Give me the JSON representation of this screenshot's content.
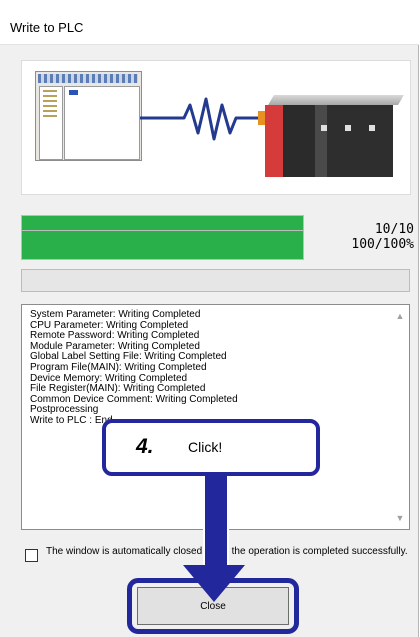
{
  "window": {
    "title": "Write to PLC"
  },
  "progress": [
    {
      "label": "10/10",
      "value": 1.0
    },
    {
      "label": "100/100%",
      "value": 1.0
    }
  ],
  "log": {
    "lines": [
      "System Parameter: Writing Completed",
      "CPU Parameter: Writing Completed",
      "Remote Password: Writing Completed",
      "Module Parameter: Writing Completed",
      "Global Label Setting File: Writing Completed",
      "Program File(MAIN): Writing Completed",
      "Device Memory: Writing Completed",
      "File Register(MAIN): Writing Completed",
      "Common Device Comment: Writing Completed",
      "Postprocessing",
      "Write to PLC : End"
    ]
  },
  "auto_close": {
    "label": "The window is automatically closed when the operation is completed successfully.",
    "checked": false
  },
  "close_button": {
    "label": "Close"
  },
  "callout": {
    "step": "4.",
    "text": "Click!"
  },
  "colors": {
    "progress_fill": "#2ab04a",
    "callout_accent": "#23279c"
  },
  "icons": {
    "scroll_up": "chevron-up-icon",
    "scroll_down": "chevron-down-icon"
  }
}
